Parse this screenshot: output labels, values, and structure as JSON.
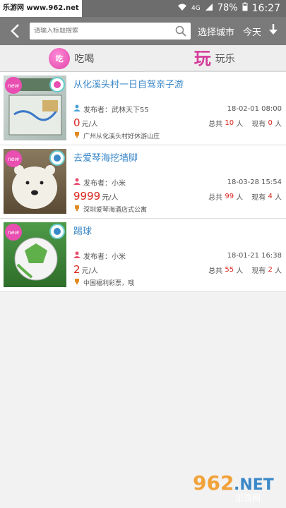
{
  "status_bar": {
    "watermark": "乐游网 www.962.net",
    "network": "4G",
    "battery": "78%",
    "time": "16:27"
  },
  "navbar": {
    "search_placeholder": "请输入标题搜索",
    "city_label": "选择城市",
    "date_label": "今天"
  },
  "tabs": [
    {
      "label": "吃喝",
      "icon_text": "吃"
    },
    {
      "label": "玩乐",
      "icon_text": "玩"
    }
  ],
  "items": [
    {
      "title": "从化溪头村一日自驾亲子游",
      "publisher": "发布者：武林天下55",
      "date": "18-02-01 08:00",
      "price": "0",
      "price_unit": "元/人",
      "total_prefix": "总共",
      "total": "10",
      "now_prefix": "现有",
      "now": "0",
      "people_unit": "人",
      "location": "广州从化溪头村好休游山庄",
      "new_badge": "new",
      "thumb_color": "#7c9a88"
    },
    {
      "title": "去爱琴海挖墙脚",
      "publisher": "发布者：小米",
      "date": "18-03-28 15:54",
      "price": "9999",
      "price_unit": "元/人",
      "total_prefix": "总共",
      "total": "99",
      "now_prefix": "现有",
      "now": "4",
      "people_unit": "人",
      "location": "深圳爱琴海酒店式公寓",
      "new_badge": "new",
      "thumb_color": "#8c7a5c"
    },
    {
      "title": "踢球",
      "publisher": "发布者：小米",
      "date": "18-01-21 16:38",
      "price": "2",
      "price_unit": "元/人",
      "total_prefix": "总共",
      "total": "55",
      "now_prefix": "现有",
      "now": "2",
      "people_unit": "人",
      "location": "中国福利彩票，哦",
      "new_badge": "new",
      "thumb_color": "#3f8a3a"
    }
  ],
  "footer_watermark": {
    "logo_text": "962",
    "domain_text": ".NET",
    "sub_text": "乐游网"
  }
}
